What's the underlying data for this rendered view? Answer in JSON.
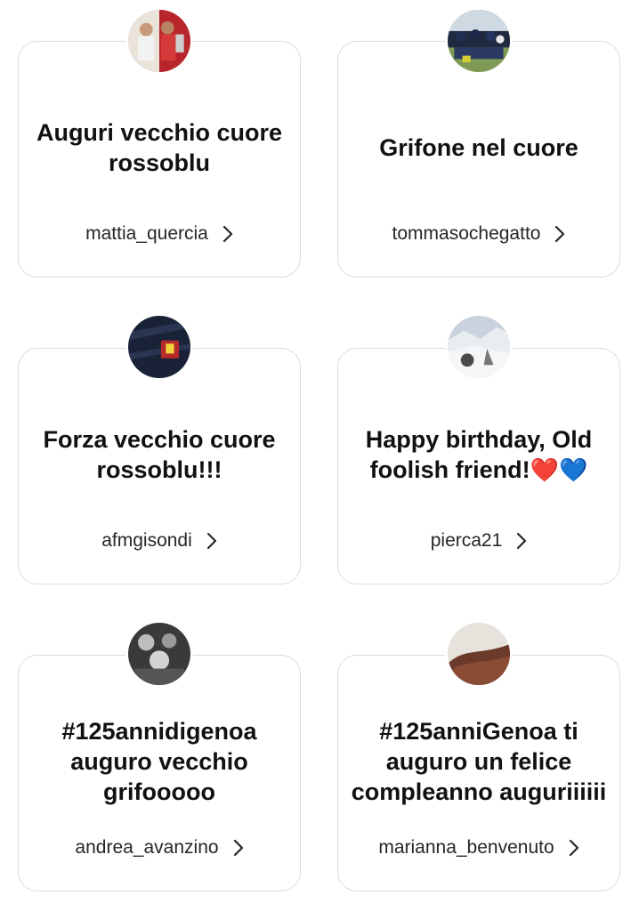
{
  "cards": [
    {
      "message": "Auguri vecchio cuore rossoblu",
      "username": "mattia_quercia",
      "avatar": "photo-two-people-trophy"
    },
    {
      "message": "Grifone nel cuore",
      "username": "tommasochegatto",
      "avatar": "photo-team-group"
    },
    {
      "message": "Forza vecchio cuore rossoblu!!!",
      "username": "afmgisondi",
      "avatar": "photo-jersey-badge"
    },
    {
      "message": "Happy birthday, Old foolish friend!",
      "emoji_red": "❤️",
      "emoji_blue": "💙",
      "username": "pierca21",
      "avatar": "photo-snow-mountain"
    },
    {
      "message": "#125annidigenoa auguro vecchio grifooooo",
      "username": "andrea_avanzino",
      "avatar": "photo-bw-friends"
    },
    {
      "message": "#125anniGenoa ti auguro un felice compleanno auguriiiiii",
      "username": "marianna_benvenuto",
      "avatar": "photo-hair-portrait"
    }
  ],
  "icons": {
    "chevron": "chevron-right-icon"
  }
}
